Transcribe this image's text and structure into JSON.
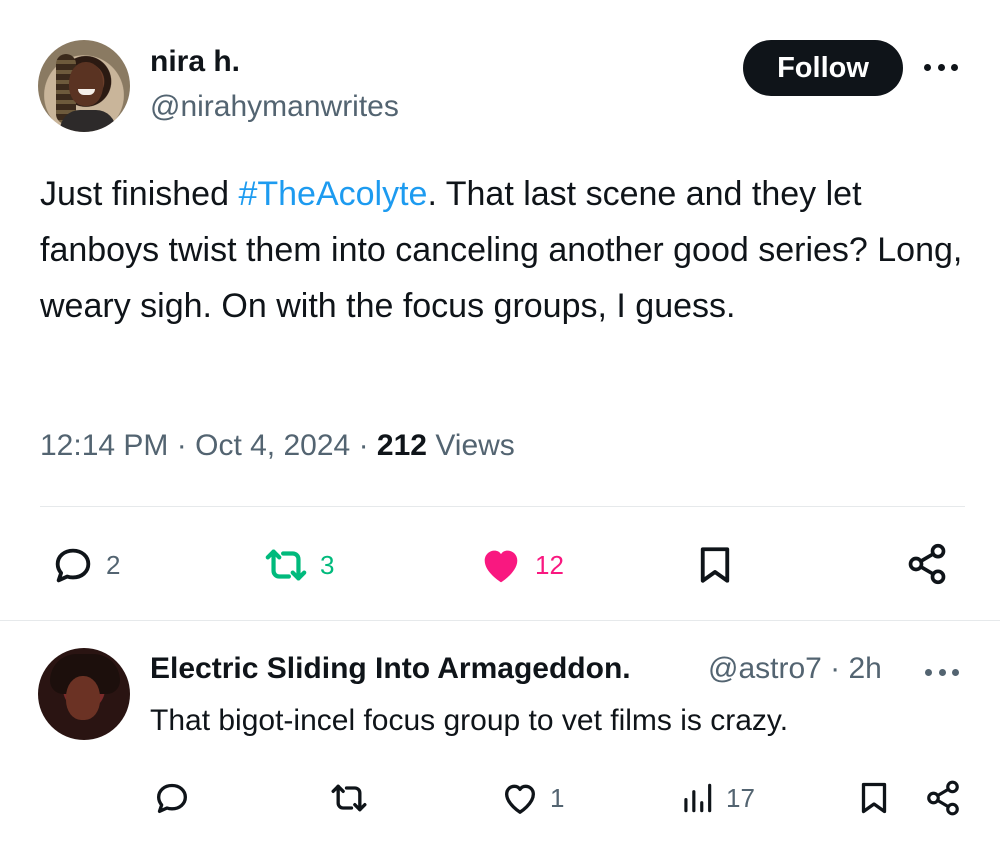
{
  "tweet": {
    "display_name": "nira h.",
    "handle": "@nirahymanwrites",
    "follow_label": "Follow",
    "text_before": "Just finished ",
    "hashtag": "#TheAcolyte",
    "text_after": ". That last scene and they let fanboys twist them into canceling another good series? Long, weary sigh. On with the focus groups, I guess.",
    "time": "12:14 PM",
    "separator": "·",
    "date": "Oct 4, 2024",
    "views_count": "212",
    "views_label": "Views",
    "actions": {
      "replies": "2",
      "reposts": "3",
      "likes": "12"
    }
  },
  "reply": {
    "display_name": "Electric Sliding Into Armageddon.",
    "handle_time": "@astro7 · 2h",
    "text": "That bigot-incel focus group to vet films is crazy.",
    "actions": {
      "likes": "1",
      "views": "17"
    }
  },
  "colors": {
    "accent": "#1d9bf0",
    "repost": "#00ba7c",
    "like": "#f91880",
    "secondary_text": "#536471",
    "primary_text": "#0f1419"
  },
  "icons": [
    "reply-icon",
    "repost-icon",
    "heart-icon",
    "bookmark-icon",
    "share-icon",
    "more-icon",
    "views-icon"
  ]
}
